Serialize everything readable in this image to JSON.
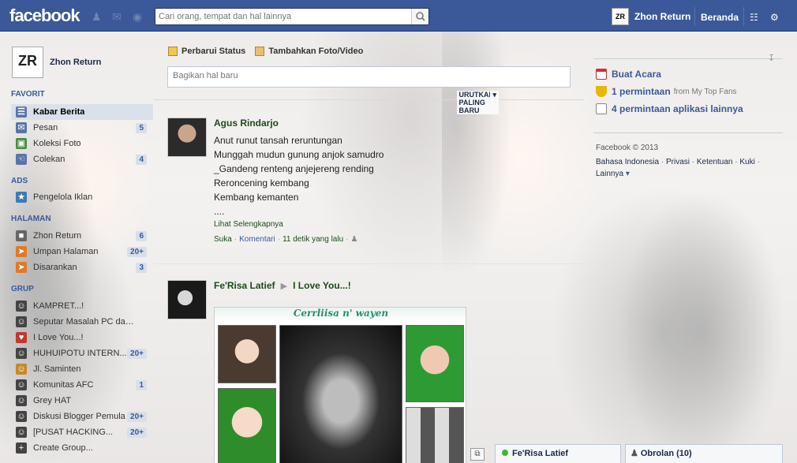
{
  "topbar": {
    "logo": "facebook",
    "search_placeholder": "Cari orang, tempat dan hal lainnya",
    "profile_avatar_text": "ZR",
    "profile_name": "Zhon Return",
    "home_label": "Beranda"
  },
  "sidebar": {
    "profile_pic_text": "ZR",
    "profile_name": "Zhon Return",
    "favorites_header": "FAVORIT",
    "favorites": [
      {
        "label": "Kabar Berita",
        "count": "",
        "icon": "news-feed-icon",
        "color": "#5b74a8"
      },
      {
        "label": "Pesan",
        "count": "5",
        "icon": "messages-icon",
        "color": "#5b74a8"
      },
      {
        "label": "Koleksi Foto",
        "count": "",
        "icon": "photos-icon",
        "color": "#4b8a3e"
      },
      {
        "label": "Colekan",
        "count": "4",
        "icon": "pokes-icon",
        "color": "#5b74a8"
      }
    ],
    "ads_header": "ADS",
    "ads": [
      {
        "label": "Pengelola Iklan",
        "count": "",
        "icon": "ads-manager-icon",
        "color": "#3b7ab8"
      }
    ],
    "pages_header": "HALAMAN",
    "pages": [
      {
        "label": "Zhon Return",
        "count": "6",
        "icon": "page-icon",
        "color": "#666"
      },
      {
        "label": "Umpan Halaman",
        "count": "20+",
        "icon": "pages-feed-icon",
        "color": "#e07a2a"
      },
      {
        "label": "Disarankan",
        "count": "3",
        "icon": "suggested-pages-icon",
        "color": "#e07a2a"
      }
    ],
    "groups_header": "GRUP",
    "groups": [
      {
        "label": "KAMPRET...!",
        "count": "",
        "icon": "group-icon",
        "color": "#444"
      },
      {
        "label": "Seputar Masalah PC dan Pr...",
        "count": "",
        "icon": "group-icon",
        "color": "#444"
      },
      {
        "label": "I Love You...!",
        "count": "",
        "icon": "group-icon",
        "color": "#c0392b"
      },
      {
        "label": "HUHUIPOTU INTERN...",
        "count": "20+",
        "icon": "group-icon",
        "color": "#444"
      },
      {
        "label": "Jl. Saminten",
        "count": "",
        "icon": "group-icon",
        "color": "#c48a2a"
      },
      {
        "label": "Komunitas AFC",
        "count": "1",
        "icon": "group-icon",
        "color": "#444"
      },
      {
        "label": "Grey HAT",
        "count": "",
        "icon": "group-icon",
        "color": "#444"
      },
      {
        "label": "Diskusi Blogger Pemula",
        "count": "20+",
        "icon": "group-icon",
        "color": "#444"
      },
      {
        "label": "[PUSAT HACKING...",
        "count": "20+",
        "icon": "group-icon",
        "color": "#444"
      },
      {
        "label": "Create Group...",
        "count": "",
        "icon": "create-group-icon",
        "color": "#444"
      }
    ]
  },
  "composer": {
    "status_tab": "Perbarui Status",
    "photo_tab": "Tambahkan Foto/Video",
    "placeholder": "Bagikan hal baru"
  },
  "feed": {
    "sort_label": "URUTKAN: PALING BARU",
    "stories": [
      {
        "actor": "Agus Rindarjo",
        "lines": [
          "Anut runut tansah reruntungan",
          "Munggah mudun gunung anjok samudro",
          "_Gandeng renteng anjejereng rending",
          "Reroncening kembang",
          "Kembang kemanten",
          "...."
        ],
        "see_more": "Lihat Selengkapnya",
        "like": "Suka",
        "comment": "Komentari",
        "time": "11 detik yang lalu"
      },
      {
        "actor": "Fe'Risa Latief",
        "target": "I Love You...!",
        "photo_caption": "Cerrliisa n' wayen"
      }
    ]
  },
  "rightcol": {
    "events": "Buat Acara",
    "requests_count": "1 permintaan",
    "requests_from": "from My Top Fans",
    "app_requests": "4 permintaan aplikasi lainnya",
    "copyright": "Facebook © 2013",
    "footer_links": [
      "Bahasa Indonesia",
      "Privasi",
      "Ketentuan",
      "Kuki",
      "Lainnya"
    ]
  },
  "chat": {
    "tab1": "Fe'Risa Latief",
    "tab2": "Obrolan (10)"
  }
}
